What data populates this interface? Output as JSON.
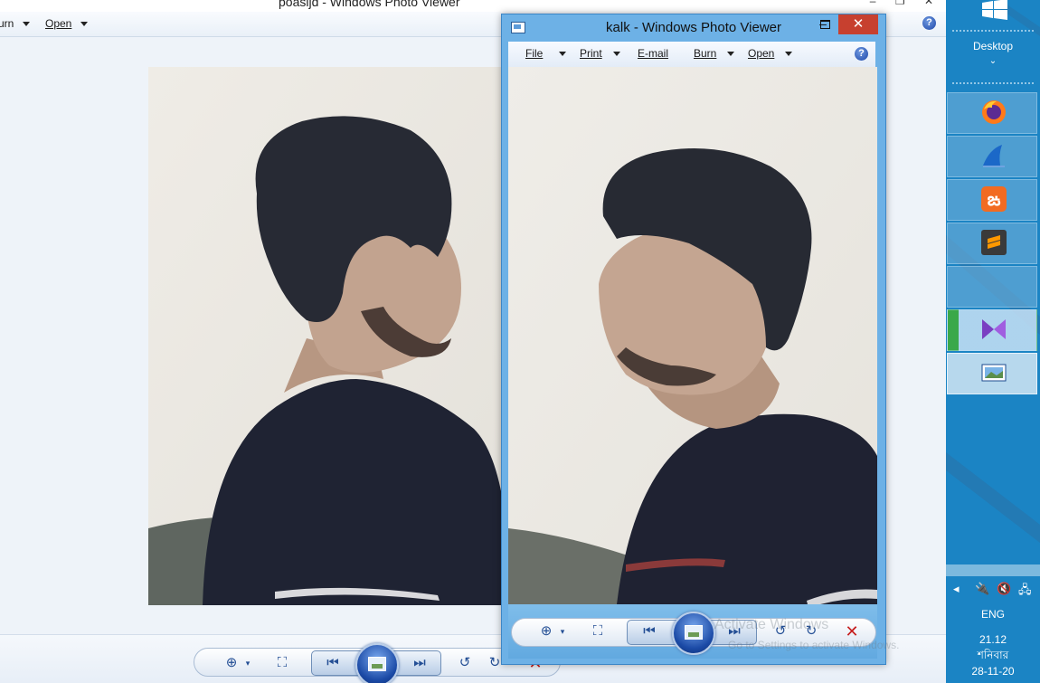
{
  "back_window": {
    "title": "poasijd - Windows Photo Viewer",
    "menu": {
      "burn": "urn",
      "open": "Open"
    },
    "help": "?"
  },
  "front_window": {
    "title": "kalk - Windows Photo Viewer",
    "menu": {
      "file": "File",
      "print": "Print",
      "email": "E-mail",
      "burn": "Burn",
      "open": "Open"
    },
    "help": "?",
    "close_glyph": "✕",
    "minimize_glyph": "‒"
  },
  "watermark": {
    "line1": "Activate Windows",
    "line2": "Go to Settings to activate Windows."
  },
  "taskbar": {
    "desktop_label": "Desktop",
    "chevron": "⌄",
    "pinned_icons": [
      "firefox-icon",
      "wireshark-icon",
      "xampp-icon",
      "sublime-text-icon",
      "blank-tile",
      "media-player-icon",
      "photo-viewer-icon"
    ],
    "language": "ENG",
    "time": "21.12",
    "day": "শনিবার",
    "date": "28-11-20"
  },
  "colors": {
    "taskbar_bg": "#1b84c4",
    "front_frame": "#6db1e6",
    "close_red": "#c7402f"
  }
}
